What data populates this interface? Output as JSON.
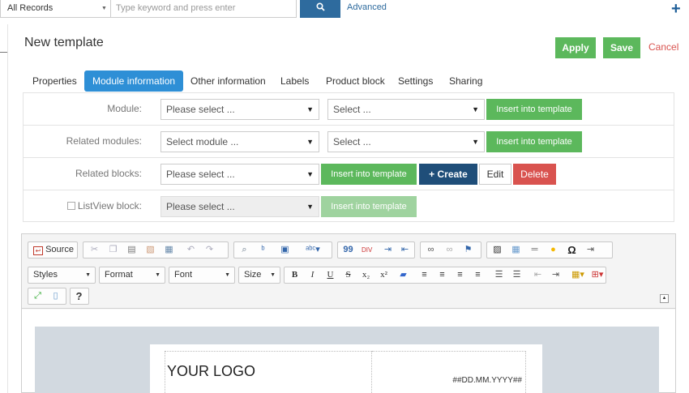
{
  "topbar": {
    "records_select": "All Records",
    "search_placeholder": "Type keyword and press enter",
    "search_icon": "🔍",
    "advanced_label": "Advanced",
    "add_icon": "+"
  },
  "page": {
    "title": "New template",
    "apply_label": "Apply",
    "save_label": "Save",
    "cancel_label": "Cancel"
  },
  "tabs": [
    {
      "label": "Properties",
      "active": false
    },
    {
      "label": "Module information",
      "active": true
    },
    {
      "label": "Other information",
      "active": false
    },
    {
      "label": "Labels",
      "active": false
    },
    {
      "label": "Product block",
      "active": false
    },
    {
      "label": "Settings",
      "active": false
    },
    {
      "label": "Sharing",
      "active": false
    }
  ],
  "form": {
    "module": {
      "label": "Module:",
      "select1": "Please select ...",
      "select2": "Select ...",
      "insert_label": "Insert into template"
    },
    "related_modules": {
      "label": "Related modules:",
      "select1": "Select module ...",
      "select2": "Select ...",
      "insert_label": "Insert into template"
    },
    "related_blocks": {
      "label": "Related blocks:",
      "select1": "Please select ...",
      "insert_label": "Insert into template",
      "create_label": "+ Create",
      "edit_label": "Edit",
      "delete_label": "Delete"
    },
    "listview_block": {
      "label": "ListView block:",
      "select1": "Please select ...",
      "insert_label": "Insert into template"
    }
  },
  "editor": {
    "source_label": "Source",
    "styles_label": "Styles",
    "format_label": "Format",
    "font_label": "Font",
    "size_label": "Size",
    "help_label": "?",
    "logo_text": "YOUR LOGO",
    "date_text": "##DD.MM.YYYY##"
  },
  "colors": {
    "primary": "#2e8fd6",
    "success": "#5cb85c",
    "danger": "#d9534f",
    "navy": "#1f4e79"
  }
}
